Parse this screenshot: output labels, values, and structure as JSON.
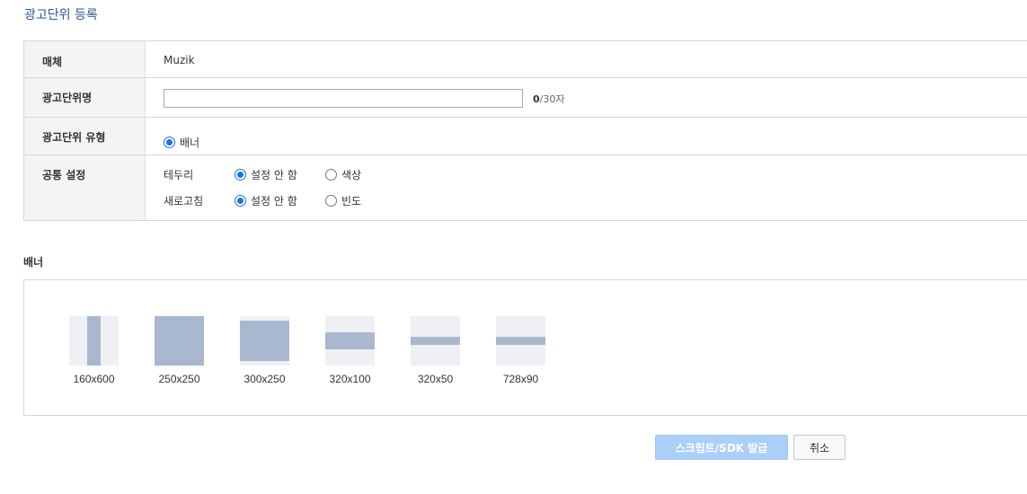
{
  "page": {
    "title": "광고단위 등록"
  },
  "form": {
    "media": {
      "label": "매체",
      "value": "Muzik"
    },
    "unit_name": {
      "label": "광고단위명",
      "value": "",
      "placeholder": "",
      "count": "0",
      "max": "/30자"
    },
    "unit_type": {
      "label": "광고단위 유형",
      "option": "배너",
      "checked": true
    },
    "common": {
      "label": "공통 설정",
      "border": {
        "name": "테두리",
        "opt_none": "설정 안 함",
        "opt_other": "색상",
        "selected": "opt_none"
      },
      "refresh": {
        "name": "새로고침",
        "opt_none": "설정 안 함",
        "opt_other": "빈도",
        "selected": "opt_none"
      }
    }
  },
  "banner": {
    "title": "배너",
    "sizes": [
      {
        "label": "160x600"
      },
      {
        "label": "250x250"
      },
      {
        "label": "300x250"
      },
      {
        "label": "320x100"
      },
      {
        "label": "320x50"
      },
      {
        "label": "728x90"
      }
    ]
  },
  "buttons": {
    "issue": "스크립트/SDK 발급",
    "cancel": "취소"
  },
  "colors": {
    "title": "#2f5597",
    "radio_checked": "#1a73e8",
    "thumb_bg": "#eef0f4",
    "thumb_fill": "#a9b7cf",
    "issue_button_bg": "#aad0f9"
  }
}
